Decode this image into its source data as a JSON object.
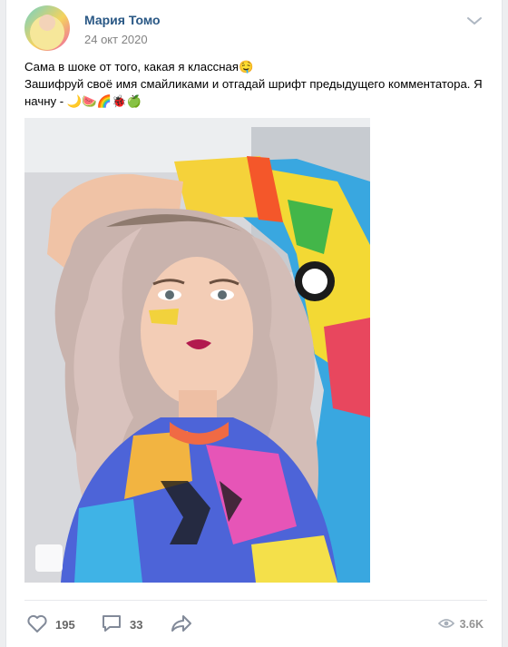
{
  "post": {
    "author": "Мария Томо",
    "date": "24 окт 2020",
    "text_line1": "Сама в шоке от того, какая я классная🤤",
    "text_line2": "Зашифруй своё имя смайликами и отгадай шрифт предыдущего комментатора. Я",
    "text_line3": "начну - 🌙🍉🌈🐞🍏",
    "image_description_icon": "photo-of-woman"
  },
  "actions": {
    "likes": "195",
    "comments": "33",
    "share_icon": "share-arrow-icon",
    "views": "3.6K"
  },
  "colors": {
    "author_link": "#2a5885",
    "meta_text": "#828282",
    "action_text": "#656565",
    "background": "#edeef0"
  }
}
